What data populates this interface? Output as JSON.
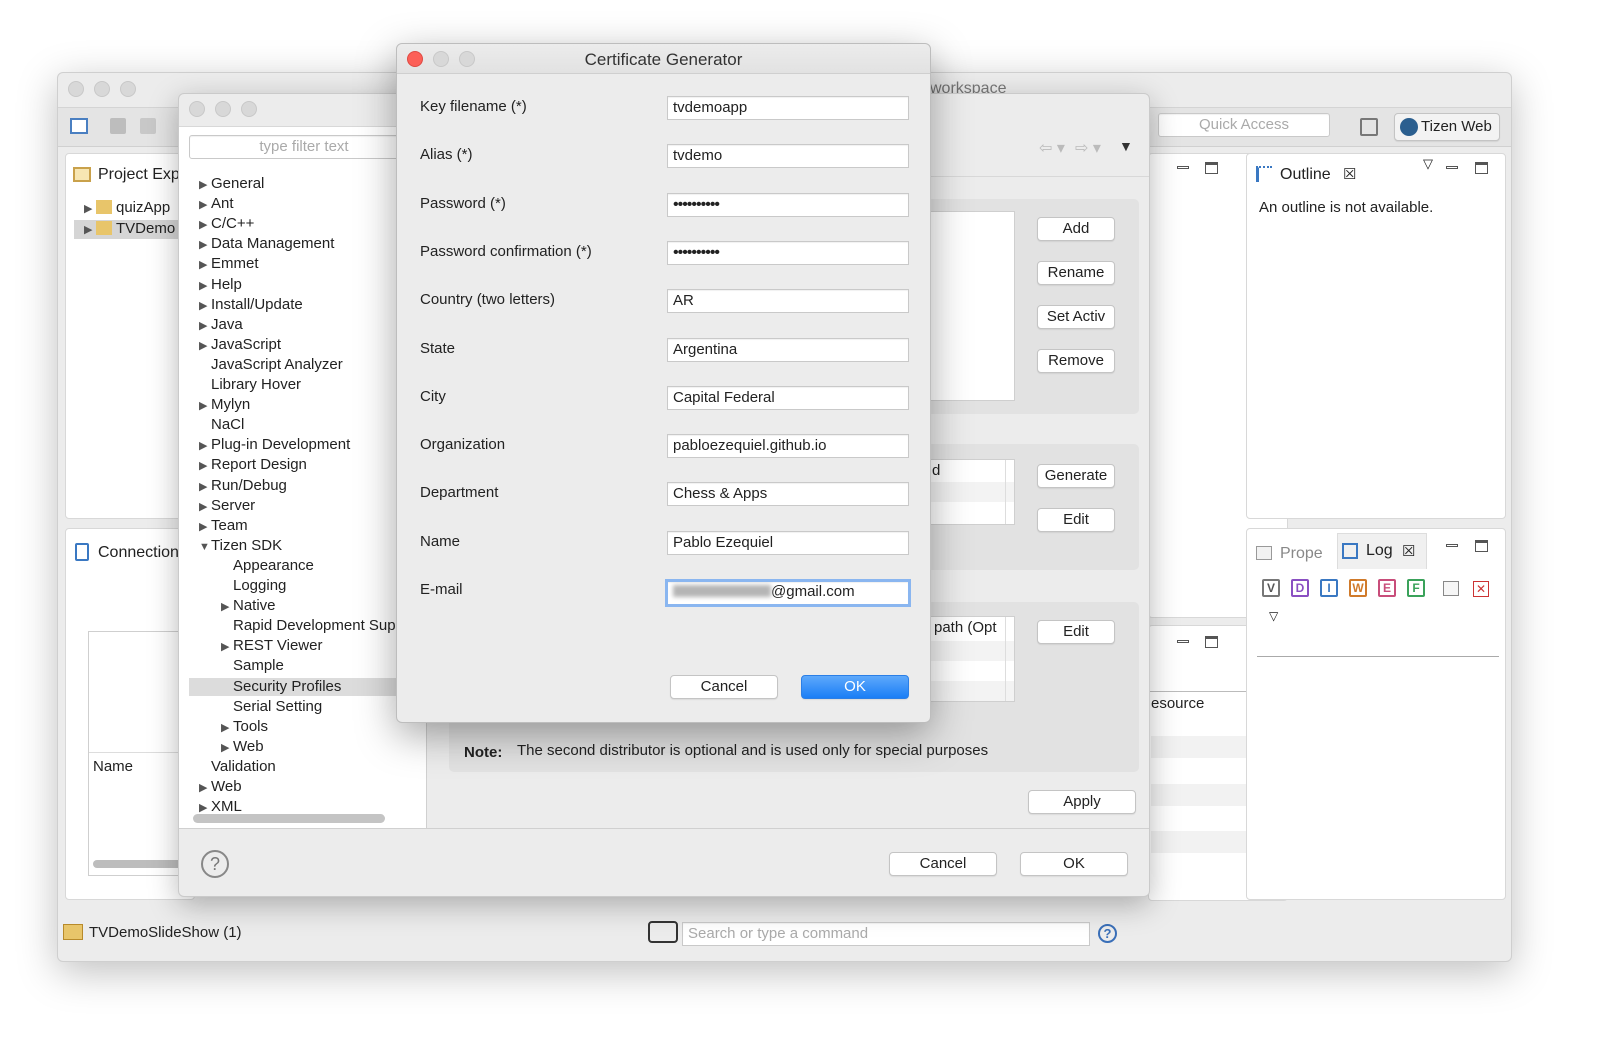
{
  "eclipse": {
    "title": "workspace",
    "quick_access": "Quick Access",
    "perspective": "Tizen Web",
    "project_explorer": "Project Exp",
    "projects": [
      "quizApp",
      "TVDemo"
    ],
    "connection": "Connection",
    "name_col": "Name",
    "outline_tab": "Outline",
    "outline_msg": "An outline is not available.",
    "prope_tab": "Prope",
    "log_tab": "Log",
    "log_levels": [
      "V",
      "D",
      "I",
      "W",
      "E",
      "F"
    ],
    "resource_col": "esource",
    "status_project": "TVDemoSlideShow (1)",
    "command_placeholder": "Search or type a command"
  },
  "preferences": {
    "filter_placeholder": "type filter text",
    "tree": [
      {
        "label": "General",
        "arrow": "▶",
        "indent": 0
      },
      {
        "label": "Ant",
        "arrow": "▶",
        "indent": 0
      },
      {
        "label": "C/C++",
        "arrow": "▶",
        "indent": 0
      },
      {
        "label": "Data Management",
        "arrow": "▶",
        "indent": 0
      },
      {
        "label": "Emmet",
        "arrow": "▶",
        "indent": 0
      },
      {
        "label": "Help",
        "arrow": "▶",
        "indent": 0
      },
      {
        "label": "Install/Update",
        "arrow": "▶",
        "indent": 0
      },
      {
        "label": "Java",
        "arrow": "▶",
        "indent": 0
      },
      {
        "label": "JavaScript",
        "arrow": "▶",
        "indent": 0
      },
      {
        "label": "JavaScript Analyzer",
        "arrow": "",
        "indent": 0
      },
      {
        "label": "Library Hover",
        "arrow": "",
        "indent": 0
      },
      {
        "label": "Mylyn",
        "arrow": "▶",
        "indent": 0
      },
      {
        "label": "NaCl",
        "arrow": "",
        "indent": 0
      },
      {
        "label": "Plug-in Development",
        "arrow": "▶",
        "indent": 0
      },
      {
        "label": "Report Design",
        "arrow": "▶",
        "indent": 0
      },
      {
        "label": "Run/Debug",
        "arrow": "▶",
        "indent": 0
      },
      {
        "label": "Server",
        "arrow": "▶",
        "indent": 0
      },
      {
        "label": "Team",
        "arrow": "▶",
        "indent": 0
      },
      {
        "label": "Tizen SDK",
        "arrow": "▼",
        "indent": 0
      },
      {
        "label": "Appearance",
        "arrow": "",
        "indent": 1
      },
      {
        "label": "Logging",
        "arrow": "",
        "indent": 1
      },
      {
        "label": "Native",
        "arrow": "▶",
        "indent": 1
      },
      {
        "label": "Rapid Development Sup",
        "arrow": "",
        "indent": 1
      },
      {
        "label": "REST Viewer",
        "arrow": "▶",
        "indent": 1
      },
      {
        "label": "Sample",
        "arrow": "",
        "indent": 1
      },
      {
        "label": "Security Profiles",
        "arrow": "",
        "indent": 1,
        "selected": true
      },
      {
        "label": "Serial Setting",
        "arrow": "",
        "indent": 1
      },
      {
        "label": "Tools",
        "arrow": "▶",
        "indent": 1
      },
      {
        "label": "Web",
        "arrow": "▶",
        "indent": 1
      },
      {
        "label": "Validation",
        "arrow": "",
        "indent": 0
      },
      {
        "label": "Web",
        "arrow": "▶",
        "indent": 0
      },
      {
        "label": "XML",
        "arrow": "▶",
        "indent": 0
      }
    ],
    "buttons": {
      "add": "Add",
      "rename": "Rename",
      "set_active": "Set Activ",
      "remove": "Remove",
      "generate": "Generate",
      "edit1": "Edit",
      "edit2": "Edit",
      "apply": "Apply",
      "cancel": "Cancel",
      "ok": "OK"
    },
    "partial_d": "d",
    "partial_path": "path (Opt",
    "note_label": "Note:",
    "note_text": "The second distributor is optional and is used only for special purposes"
  },
  "dialog": {
    "title": "Certificate Generator",
    "fields": [
      {
        "label": "Key filename (*)",
        "value": "tvdemoapp"
      },
      {
        "label": "Alias (*)",
        "value": "tvdemo"
      },
      {
        "label": "Password (*)",
        "value": "••••••••••"
      },
      {
        "label": "Password confirmation (*)",
        "value": "••••••••••"
      },
      {
        "label": "Country (two letters)",
        "value": "AR"
      },
      {
        "label": "State",
        "value": "Argentina"
      },
      {
        "label": "City",
        "value": "Capital Federal"
      },
      {
        "label": "Organization",
        "value": "pabloezequiel.github.io"
      },
      {
        "label": "Department",
        "value": "Chess & Apps"
      },
      {
        "label": "Name",
        "value": "Pablo Ezequiel"
      },
      {
        "label": "E-mail",
        "value": "@gmail.com"
      }
    ],
    "cancel": "Cancel",
    "ok": "OK"
  }
}
